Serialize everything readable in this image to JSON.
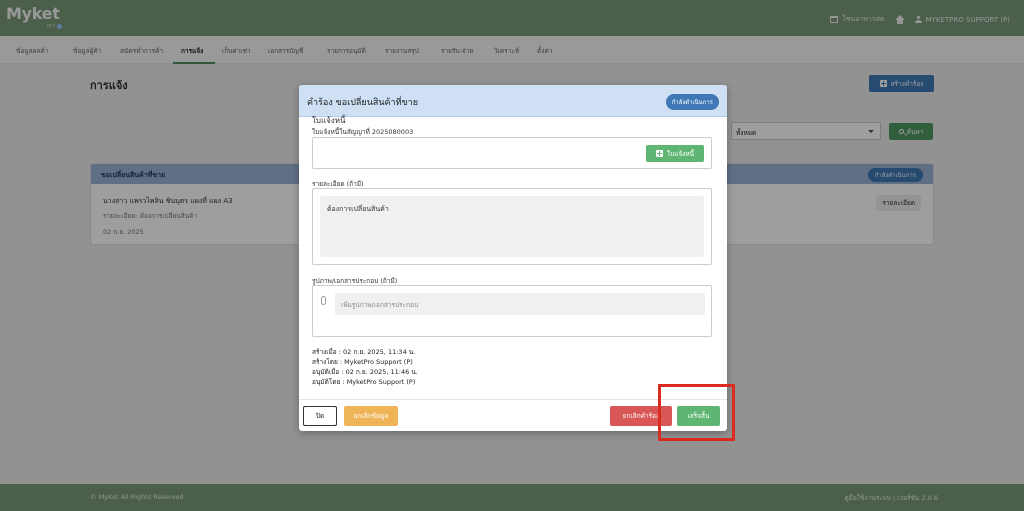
{
  "app": {
    "logo": "Myket",
    "logo_sub": "pro"
  },
  "topbar": {
    "store_label": "โชนอาหารสด",
    "user_label": "MYKETPRO SUPPORT (P)"
  },
  "nav": {
    "items": [
      {
        "label": "ข้อมูลผลค้า"
      },
      {
        "label": "ข้อมูลผู้ค้า"
      },
      {
        "label": "สมัครทำการค้า"
      },
      {
        "label": "การแจ้ง"
      },
      {
        "label": "เก็บค่าเช่า"
      },
      {
        "label": "เอกสารบัญชี"
      },
      {
        "label": "รายการอนุมัติ"
      },
      {
        "label": "รายงานสรุป"
      },
      {
        "label": "รายรับ-จ่าย"
      },
      {
        "label": "วิเคราะห์"
      },
      {
        "label": "ตั้งค่า"
      }
    ],
    "active": "การแจ้ง"
  },
  "page": {
    "title": "การแจ้ง",
    "create_button": "สร้างคำร้อง",
    "filter_value": "ทั้งหมด",
    "search_button": "ค้นหา"
  },
  "card": {
    "header": "ขอเปลี่ยนสินค้าที่ขาย",
    "badge": "กำลังดำเนินการ",
    "line1": "นางสาว แพรวไพลิน ชินบุตร แผงที่ แผง A3",
    "line2": "รายละเอียด: ต้องการเปลี่ยนสินค้า",
    "date": "02 ก.ย. 2025",
    "detail_button": "รายละเอียด"
  },
  "footer": {
    "left": "© MyKet All Rights Reserved",
    "right": "คู่มือใช้งานระบบ | เวอร์ชัน 2.0.6"
  },
  "modal": {
    "title": "คำร้อง ขอเปลี่ยนสินค้าที่ขาย",
    "badge": "กำลังดำเนินการ",
    "section_title": "ใบแจ้งหนี้",
    "invoice_label": "ใบแจ้งหนี้ในสัญญาที่ 2025080003",
    "invoice_button": "ใบแจ้งหนี้",
    "detail_label": "รายละเอียด (ถ้ามี)",
    "detail_value": "ต้องการเปลี่ยนสินค้า",
    "attach_label": "รูปภาพ/เอกสารประกอบ (ถ้ามี)",
    "attach_placeholder": "เพิ่มรูปภาพ/เอกสารประกอบ",
    "meta": {
      "created_at": "สร้างเมื่อ : 02 ก.ย. 2025, 11:34 น.",
      "created_by": "สร้างโดย : MyketPro Support (P)",
      "approved_at": "อนุมัติเมื่อ : 02 ก.ย. 2025, 11:46 น.",
      "approved_by": "อนุมัติโดย : MyketPro Support (P)"
    },
    "buttons": {
      "close": "ปิด",
      "cancel_data": "ยกเลิกข้อมูล",
      "reject": "ยกเลิกคำร้อง",
      "finish": "เสร็จสิ้น"
    }
  },
  "colors": {
    "header_green": "#7a997a",
    "primary_blue": "#3f78b5",
    "success_green": "#5fb672",
    "danger_red": "#d95757",
    "warning_orange": "#f0b458",
    "highlight_red": "#d92b22"
  }
}
